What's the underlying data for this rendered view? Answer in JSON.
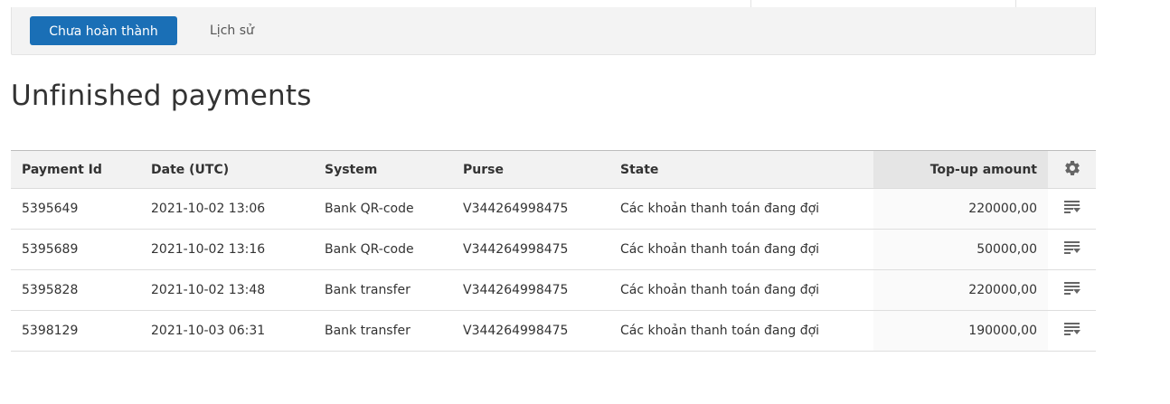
{
  "subnav": {
    "active_tab_label": "Chưa hoàn thành",
    "history_tab_label": "Lịch sử"
  },
  "page": {
    "title": "Unfinished payments"
  },
  "table": {
    "headers": {
      "payment_id": "Payment Id",
      "date": "Date (UTC)",
      "system": "System",
      "purse": "Purse",
      "state": "State",
      "amount": "Top-up amount"
    },
    "sorted_column": "amount",
    "settings_icon": "gear-icon",
    "row_action_icon": "list-dropdown-icon",
    "rows": [
      {
        "payment_id": "5395649",
        "date": "2021-10-02 13:06",
        "system": "Bank QR-code",
        "purse": "V344264998475",
        "state": "Các khoản thanh toán đang đợi",
        "amount": "220000,00"
      },
      {
        "payment_id": "5395689",
        "date": "2021-10-02 13:16",
        "system": "Bank QR-code",
        "purse": "V344264998475",
        "state": "Các khoản thanh toán đang đợi",
        "amount": "50000,00"
      },
      {
        "payment_id": "5395828",
        "date": "2021-10-02 13:48",
        "system": "Bank transfer",
        "purse": "V344264998475",
        "state": "Các khoản thanh toán đang đợi",
        "amount": "220000,00"
      },
      {
        "payment_id": "5398129",
        "date": "2021-10-03 06:31",
        "system": "Bank transfer",
        "purse": "V344264998475",
        "state": "Các khoản thanh toán đang đợi",
        "amount": "190000,00"
      }
    ]
  },
  "colors": {
    "primary_button": "#1a6fb6",
    "subnav_background": "#f3f3f3",
    "header_background": "#f2f2f2",
    "sorted_header_background": "#e5e5e5",
    "icon_gray": "#666666"
  }
}
